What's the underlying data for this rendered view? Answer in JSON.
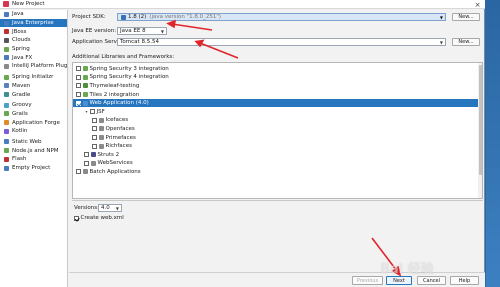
{
  "window": {
    "title": "New Project",
    "close_glyph": "×"
  },
  "sidebar": {
    "items": [
      {
        "label": "Java",
        "icon": "java-folder-icon",
        "color": "#4a7bc0"
      },
      {
        "label": "Java Enterprise",
        "icon": "java-ee-icon",
        "color": "#4a7bc0",
        "selected": true
      },
      {
        "label": "JBoss",
        "icon": "jboss-icon",
        "color": "#c03030"
      },
      {
        "label": "Clouds",
        "icon": "cloud-icon",
        "color": "#555555"
      },
      {
        "label": "Spring",
        "icon": "spring-icon",
        "color": "#6aa84f"
      },
      {
        "label": "Java FX",
        "icon": "javafx-icon",
        "color": "#4a7bc0"
      },
      {
        "label": "IntelliJ Platform Plugin",
        "icon": "plugin-icon",
        "color": "#8a8a8a"
      },
      {
        "label": "Spring Initializr",
        "icon": "spring-initializr-icon",
        "color": "#6aa84f"
      },
      {
        "label": "Maven",
        "icon": "maven-icon",
        "color": "#5a7fbf"
      },
      {
        "label": "Gradle",
        "icon": "gradle-icon",
        "color": "#3f8f8f"
      },
      {
        "label": "Groovy",
        "icon": "groovy-icon",
        "color": "#4aa0c8"
      },
      {
        "label": "Grails",
        "icon": "grails-icon",
        "color": "#6aa84f"
      },
      {
        "label": "Application Forge",
        "icon": "forge-icon",
        "color": "#e08a2a"
      },
      {
        "label": "Kotlin",
        "icon": "kotlin-icon",
        "color": "#7d5ad6"
      },
      {
        "label": "Static Web",
        "icon": "static-web-icon",
        "color": "#4a7bc0"
      },
      {
        "label": "Node.js and NPM",
        "icon": "nodejs-icon",
        "color": "#6aa84f"
      },
      {
        "label": "Flash",
        "icon": "flash-icon",
        "color": "#c03030"
      },
      {
        "label": "Empty Project",
        "icon": "empty-project-icon",
        "color": "#4a7bc0"
      }
    ]
  },
  "form": {
    "sdk_label": "Project SDK:",
    "sdk_value": "1.8 (2)",
    "sdk_detail": "(java version \"1.8.0_251\")",
    "new_button": "New...",
    "ee_label": "Java EE version:",
    "ee_value": "Java EE 8",
    "server_label": "Application Server:",
    "server_value": "Tomcat 8.5.54",
    "server_new_button": "New...",
    "libs_label": "Additional Libraries and Frameworks:"
  },
  "libraries": [
    {
      "label": "Spring Security 3 integration",
      "checked": false,
      "level": 0,
      "icon_color": "#6aa84f"
    },
    {
      "label": "Spring Security 4 integration",
      "checked": false,
      "level": 0,
      "icon_color": "#6aa84f"
    },
    {
      "label": "Thymeleaf-testing",
      "checked": false,
      "level": 0,
      "icon_color": "#4f8f3a"
    },
    {
      "label": "Tiles 2 integration",
      "checked": false,
      "level": 0,
      "icon_color": "#6aa84f"
    },
    {
      "label": "Web Application (4.0)",
      "checked": true,
      "level": 0,
      "icon_color": "#4a90d0",
      "selected": true
    },
    {
      "label": "JSF",
      "checked": false,
      "level": 1,
      "icon_color": "",
      "twisty": "▾"
    },
    {
      "label": "Icefaces",
      "checked": false,
      "level": 2,
      "icon_color": "#8a8a8a"
    },
    {
      "label": "Openfaces",
      "checked": false,
      "level": 2,
      "icon_color": "#8a8a8a"
    },
    {
      "label": "Primefaces",
      "checked": false,
      "level": 2,
      "icon_color": "#8a8a8a"
    },
    {
      "label": "Richfaces",
      "checked": false,
      "level": 2,
      "icon_color": "#8a8a8a"
    },
    {
      "label": "Struts 2",
      "checked": false,
      "level": 1,
      "icon_color": "#4a4a8a"
    },
    {
      "label": "WebServices",
      "checked": false,
      "level": 1,
      "icon_color": "#8a8a8a"
    },
    {
      "label": "Batch Applications",
      "checked": false,
      "level": 0,
      "icon_color": "#8a8a8a"
    }
  ],
  "lower": {
    "versions_label": "Versions:",
    "versions_value": "4.0",
    "create_webxml_label": "Create web.xml",
    "create_webxml_checked": true
  },
  "footer": {
    "previous": "Previous",
    "next": "Next",
    "cancel": "Cancel",
    "help": "Help"
  },
  "watermark": "Bai 经验",
  "colors": {
    "accent": "#2675bf",
    "annotation_red": "#e0252b"
  }
}
